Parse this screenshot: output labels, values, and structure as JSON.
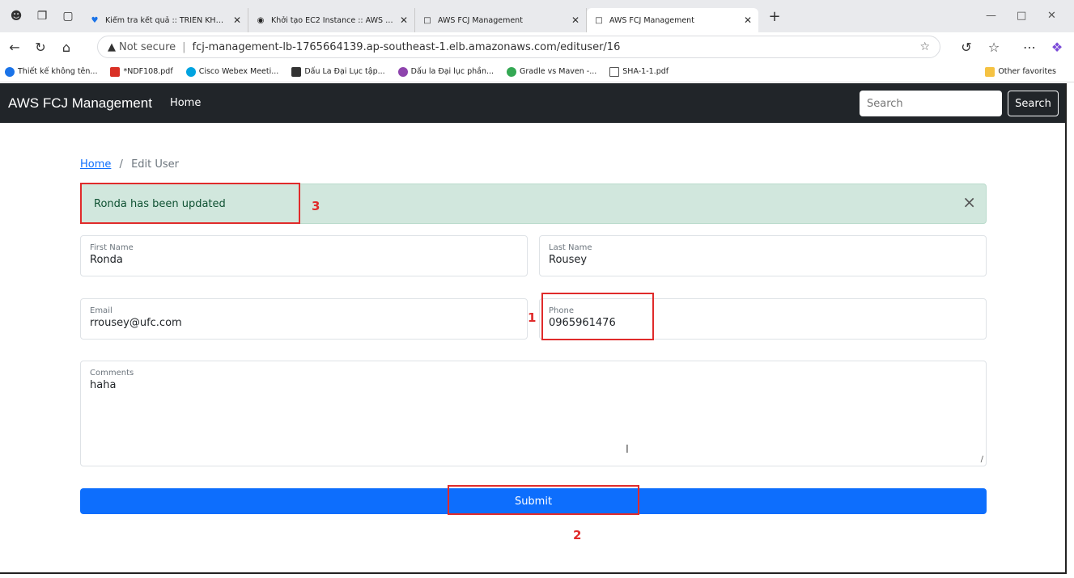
{
  "browser": {
    "tabs": [
      {
        "title": "Kiểm tra kết quả :: TRIỂN KHAI ỨN",
        "active": false
      },
      {
        "title": "Khởi tạo EC2 Instance :: AWS Syst",
        "active": false
      },
      {
        "title": "AWS FCJ Management",
        "active": false
      },
      {
        "title": "AWS FCJ Management",
        "active": true
      }
    ],
    "new_tab_label": "+",
    "url_not_secure": "Not secure",
    "url": "fcj-management-lb-1765664139.ap-southeast-1.elb.amazonaws.com/edituser/16",
    "bookmarks": [
      {
        "label": "Thiết kế không tên...",
        "color": "#1a73e8"
      },
      {
        "label": "*NDF108.pdf",
        "color": "#d93025"
      },
      {
        "label": "Cisco Webex Meeti...",
        "color": "#00a3e0"
      },
      {
        "label": "Dấu La Đại Lục tập...",
        "color": "#333333"
      },
      {
        "label": "Dấu la Đại lục phần...",
        "color": "#8e44ad"
      },
      {
        "label": "Gradle vs Maven -...",
        "color": "#34a853"
      },
      {
        "label": "SHA-1-1.pdf",
        "color": "#555555"
      }
    ],
    "other_favorites": "Other favorites"
  },
  "navbar": {
    "brand": "AWS FCJ Management",
    "home": "Home",
    "search_placeholder": "Search",
    "search_button": "Search"
  },
  "breadcrumb": {
    "home": "Home",
    "separator": "/",
    "current": "Edit User"
  },
  "alert": {
    "message": "Ronda has been updated",
    "close": "×"
  },
  "form": {
    "first_name": {
      "label": "First Name",
      "value": "Ronda"
    },
    "last_name": {
      "label": "Last Name",
      "value": "Rousey"
    },
    "email": {
      "label": "Email",
      "value": "rrousey@ufc.com"
    },
    "phone": {
      "label": "Phone",
      "value": "0965961476"
    },
    "comments": {
      "label": "Comments",
      "value": "haha"
    },
    "submit": "Submit"
  },
  "annotations": {
    "one": "1",
    "two": "2",
    "three": "3",
    "color": "#e02b2b"
  }
}
